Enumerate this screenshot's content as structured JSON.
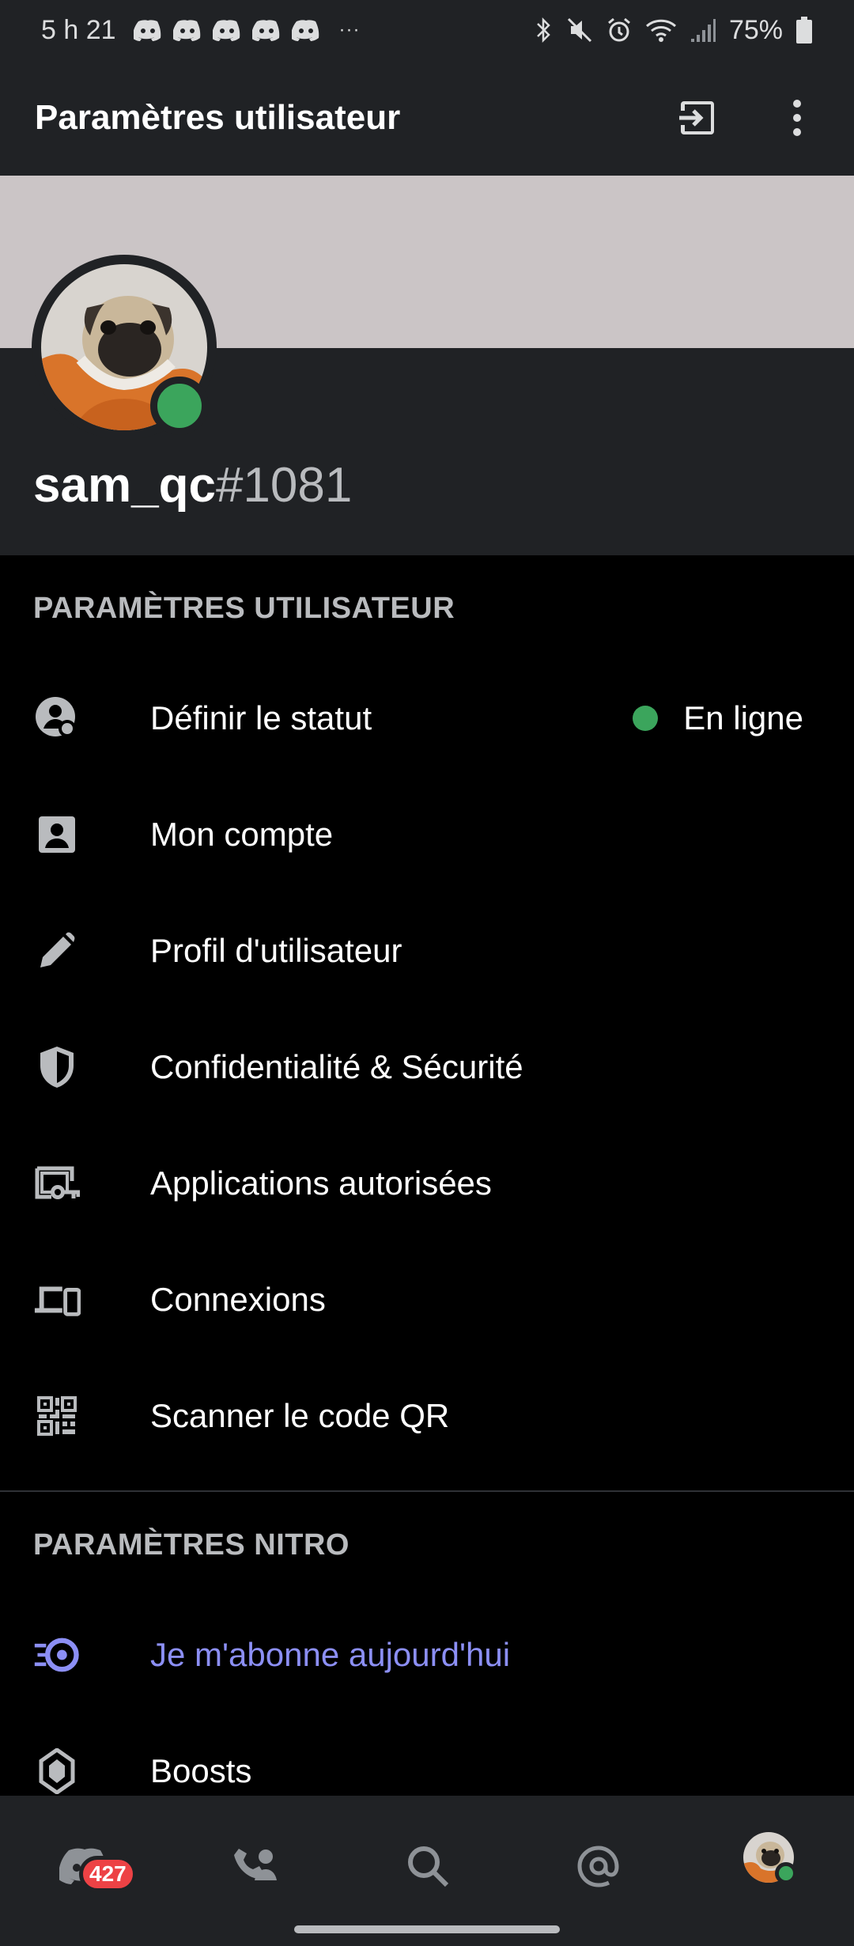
{
  "status_bar": {
    "time": "5 h 21",
    "more": "···",
    "battery": "75%",
    "notification_icons": [
      "discord-icon",
      "discord-icon",
      "discord-icon",
      "discord-icon",
      "discord-icon"
    ]
  },
  "header": {
    "title": "Paramètres utilisateur",
    "actions": [
      "logout-icon",
      "more-vert-icon"
    ]
  },
  "profile": {
    "username": "sam_qc",
    "discriminator": "#1081",
    "status_color": "#3ba55c",
    "banner_color": "#cbc5c6"
  },
  "user_settings": {
    "header": "PARAMÈTRES UTILISATEUR",
    "items": [
      {
        "label": "Définir le statut",
        "icon": "status-icon",
        "value": "En ligne"
      },
      {
        "label": "Mon compte",
        "icon": "account-icon"
      },
      {
        "label": "Profil d'utilisateur",
        "icon": "pencil-icon"
      },
      {
        "label": "Confidentialité & Sécurité",
        "icon": "shield-icon"
      },
      {
        "label": "Applications autorisées",
        "icon": "apps-key-icon"
      },
      {
        "label": "Connexions",
        "icon": "devices-icon"
      },
      {
        "label": "Scanner le code QR",
        "icon": "qr-code-icon"
      }
    ]
  },
  "nitro_settings": {
    "header": "PARAMÈTRES NITRO",
    "items": [
      {
        "label": "Je m'abonne aujourd'hui",
        "icon": "nitro-icon"
      },
      {
        "label": "Boosts",
        "icon": "boost-icon"
      }
    ]
  },
  "bottom_nav": {
    "home_badge": "427",
    "items": [
      "home-icon",
      "friends-icon",
      "search-icon",
      "mentions-icon",
      "profile-avatar"
    ]
  },
  "colors": {
    "background": "#000000",
    "surface": "#202225",
    "accent_nitro": "#8c8ff5",
    "online": "#3ba55c",
    "badge": "#ed4245"
  }
}
